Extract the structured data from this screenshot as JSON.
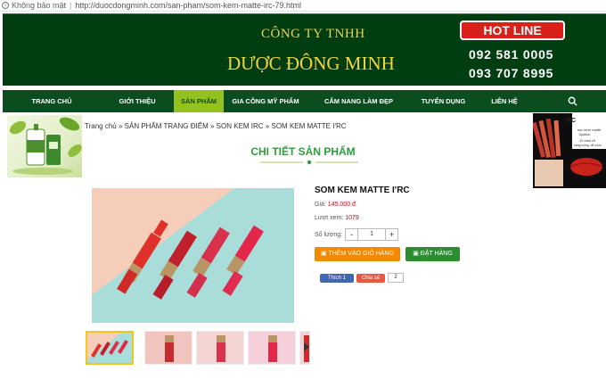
{
  "browser": {
    "security_text": "Không bảo mật",
    "url": "http://duocdongminh.com/san-pham/som-kem-matte-irc-79.html"
  },
  "header": {
    "company_small": "CÔNG TY TNHH",
    "company_big": "DƯỢC ĐÔNG MINH",
    "hotline_label": "HOT LINE",
    "phone1": "092 581 0005",
    "phone2": "093 707 8995"
  },
  "nav": {
    "items": [
      {
        "label": "TRANG CHỦ"
      },
      {
        "label": "GIỚI THIỆU"
      },
      {
        "label": "SẢN PHẨM"
      },
      {
        "label": "GIA CÔNG MỸ PHẨM"
      },
      {
        "label": "CẨM NANG LÀM ĐẸP"
      },
      {
        "label": "TUYỂN DỤNG"
      },
      {
        "label": "LIÊN HỆ"
      }
    ],
    "active_index": 2,
    "search_icon": "search-icon"
  },
  "breadcrumb": {
    "home": "Trang chủ",
    "cat1": "SẢN PHẨM TRANG ĐIỂM",
    "cat2": "SON KEM IRC",
    "current": "SOM KEM MATTE I'RC",
    "separator": "»"
  },
  "section_title": "CHI TIẾT SẢN PHẨM",
  "right_ad": {
    "brand": "IRC",
    "line1": "son kem matte",
    "line2": "lipstick",
    "line3": "10 cam rã",
    "line4": "sang trọng, dễ cuốn"
  },
  "product": {
    "name": "SOM KEM MATTE I'RC",
    "price_label": "Giá:",
    "price_value": "145.000 đ",
    "views_label": "Lượt xem:",
    "views_value": "1079",
    "qty_label": "Số lượng:",
    "qty_minus": "-",
    "qty_value": "1",
    "qty_plus": "+",
    "add_to_cart": "THÊM VÀO GIỎ HÀNG",
    "order": "ĐẶT HÀNG",
    "like_label": "Thích 1",
    "share_label": "Chia sẻ",
    "share_count": "2"
  },
  "thumbnails": {
    "count": 5,
    "selected_index": 0
  },
  "colors": {
    "header_bg": "#003e12",
    "nav_bg": "#0b4d1e",
    "nav_active": "#95c11f",
    "accent_gold": "#f4d63a",
    "hotline_red": "#d9201a",
    "title_green": "#2e9e3c",
    "cart_orange": "#f18a00",
    "order_green": "#2c8d30",
    "price_red": "#d0021b"
  }
}
